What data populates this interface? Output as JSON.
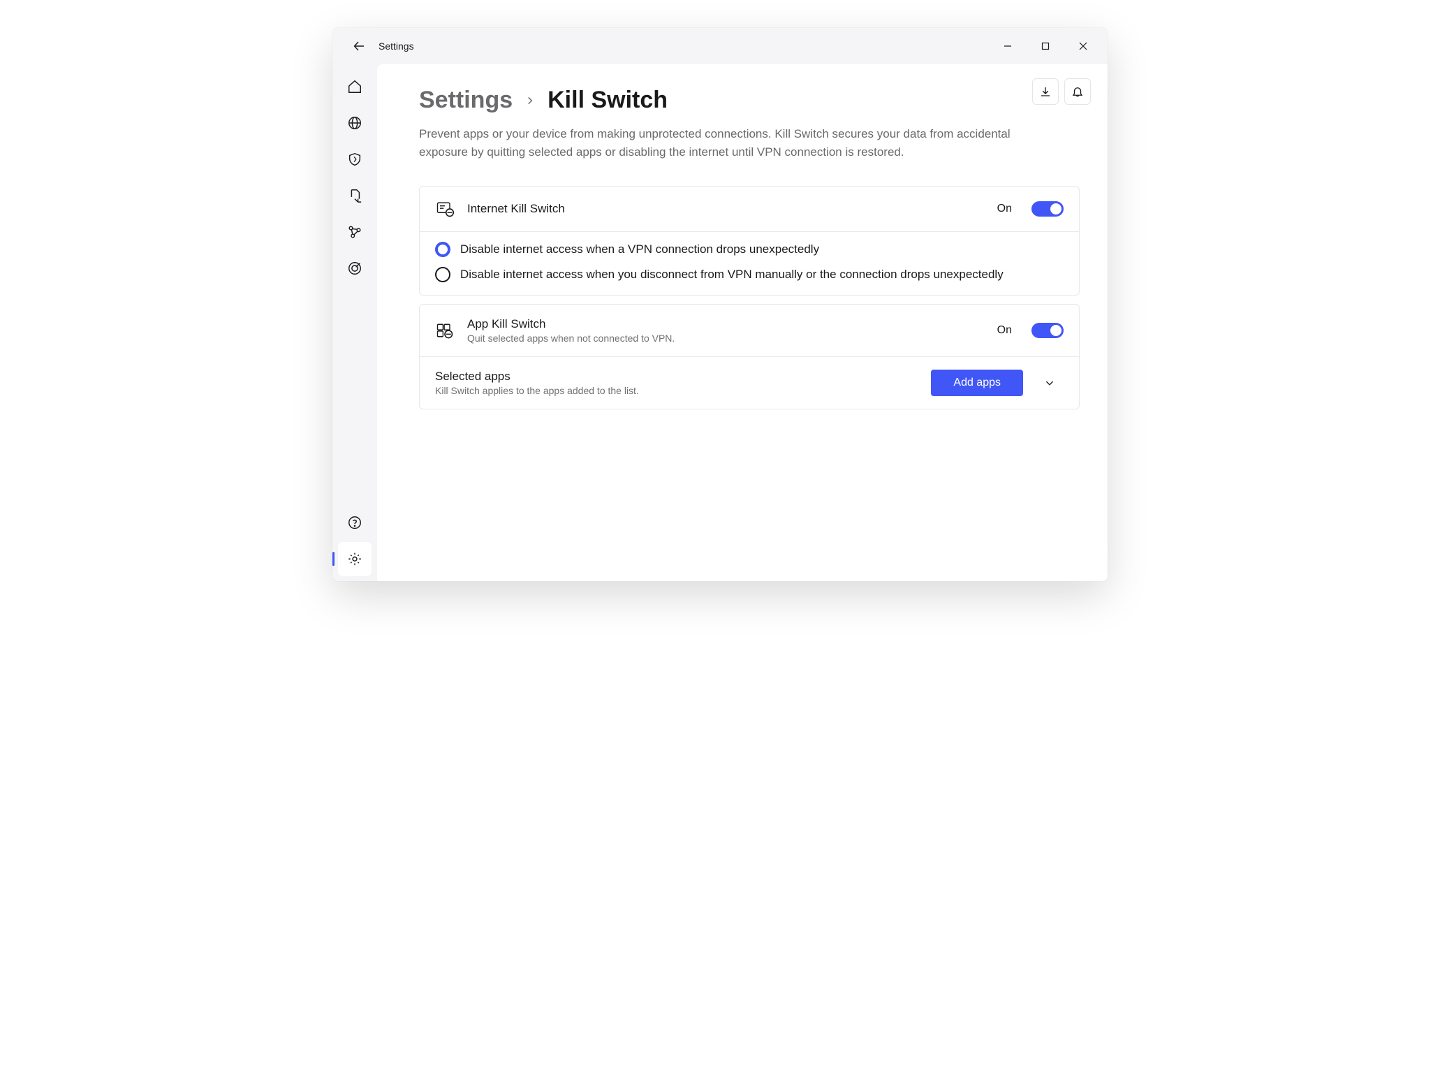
{
  "titlebar": {
    "title": "Settings"
  },
  "breadcrumb": {
    "parent": "Settings",
    "current": "Kill Switch"
  },
  "page": {
    "description": "Prevent apps or your device from making unprotected connections. Kill Switch secures your data from accidental exposure by quitting selected apps or disabling the internet until VPN connection is restored."
  },
  "internet_ks": {
    "title": "Internet Kill Switch",
    "state": "On",
    "options": {
      "opt1": "Disable internet access when a VPN connection drops unexpectedly",
      "opt2": "Disable internet access when you disconnect from VPN manually or the connection drops unexpectedly"
    }
  },
  "app_ks": {
    "title": "App Kill Switch",
    "subtitle": "Quit selected apps when not connected to VPN.",
    "state": "On"
  },
  "selected_apps": {
    "title": "Selected apps",
    "subtitle": "Kill Switch applies to the apps added to the list.",
    "button": "Add apps"
  }
}
